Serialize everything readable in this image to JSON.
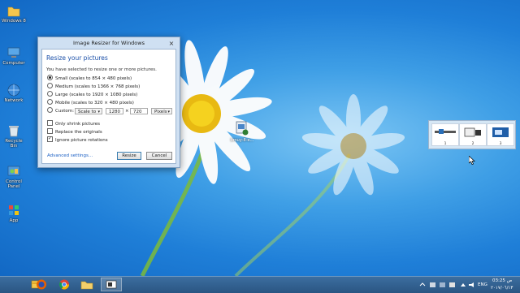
{
  "desktop": {
    "icons": [
      {
        "name": "folder-icon",
        "label": "Windows 8"
      },
      {
        "name": "computer-icon",
        "label": "Computer"
      },
      {
        "name": "network-icon",
        "label": "Network"
      },
      {
        "name": "recycle-bin-icon",
        "label": "Recycle Bin"
      },
      {
        "name": "control-panel-icon",
        "label": "Control Panel"
      },
      {
        "name": "app-icon",
        "label": "App"
      }
    ],
    "file_label": "bmuy-8-e...",
    "accent": "#1f7fd8"
  },
  "dialog": {
    "title": "Image Resizer for Windows",
    "close_glyph": "×",
    "heading": "Resize your pictures",
    "description": "You have selected to resize one or more pictures.",
    "options": [
      {
        "label": "Small (scales to 854 × 480 pixels)",
        "selected": true
      },
      {
        "label": "Medium (scales to 1366 × 768 pixels)",
        "selected": false
      },
      {
        "label": "Large (scales to 1920 × 1080 pixels)",
        "selected": false
      },
      {
        "label": "Mobile (scales to 320 × 480 pixels)",
        "selected": false
      },
      {
        "label": "Custom:",
        "selected": false
      }
    ],
    "custom": {
      "mode": "Scale to",
      "width": "1280",
      "x": "×",
      "height": "720",
      "unit": "Pixels"
    },
    "checkboxes": [
      {
        "label": "Only shrink pictures",
        "checked": false
      },
      {
        "label": "Replace the originals",
        "checked": false
      },
      {
        "label": "Ignore picture rotations",
        "checked": true
      }
    ],
    "advanced_link": "Advanced settings...",
    "resize_button": "Resize",
    "cancel_button": "Cancel"
  },
  "thumbnails": [
    {
      "caption": "1"
    },
    {
      "caption": "2"
    },
    {
      "caption": "3"
    }
  ],
  "taskbar": {
    "apps": [
      {
        "name": "explorer-icon"
      },
      {
        "name": "firefox-icon"
      },
      {
        "name": "chrome-icon"
      },
      {
        "name": "folder-icon"
      },
      {
        "name": "image-resizer-icon"
      }
    ],
    "language": "ENG",
    "time": "03:25 ص",
    "date": "٢٠١٧/٠٦/١٣"
  }
}
